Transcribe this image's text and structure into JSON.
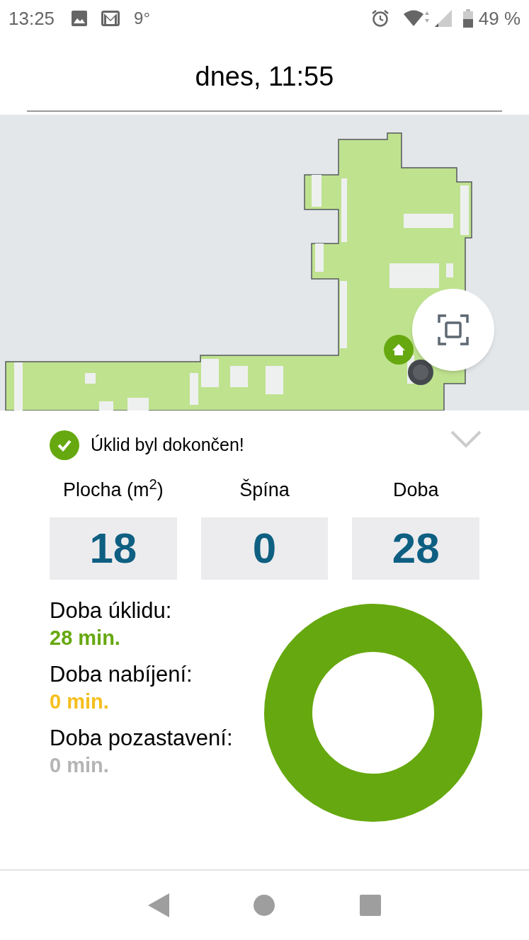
{
  "status_bar": {
    "time": "13:25",
    "temperature": "9°",
    "battery": "49 %"
  },
  "header": {
    "title": "dnes, 11:55"
  },
  "summary": {
    "message": "Úklid byl dokončen!",
    "expanded": true,
    "stats": [
      {
        "label": "Plocha (m$^{2}$)",
        "value": "18"
      },
      {
        "label": "Špína",
        "value": "0"
      },
      {
        "label": "Doba",
        "value": "28"
      }
    ],
    "durations": [
      {
        "label": "Doba úklidu:",
        "value": "28 min.",
        "color": "#66a80f"
      },
      {
        "label": "Doba nabíjení:",
        "value": "0 min.",
        "color": "#f5bf1e"
      },
      {
        "label": "Doba pozastavení:",
        "value": "0 min.",
        "color": "#b5b5b5"
      }
    ]
  }
}
